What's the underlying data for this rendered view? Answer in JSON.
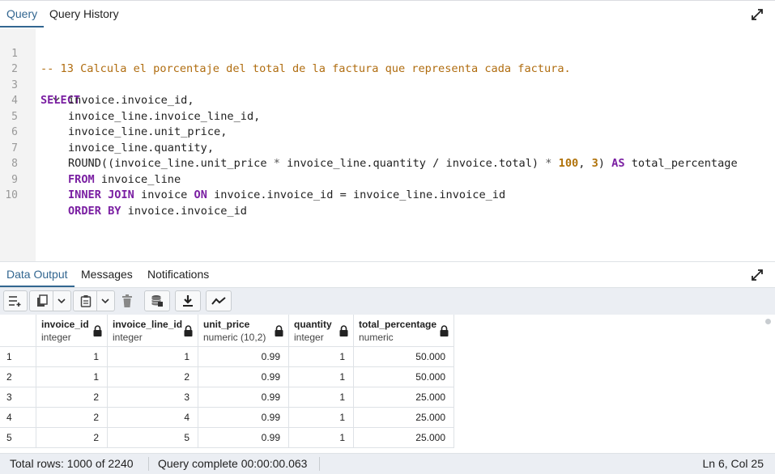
{
  "query_tabs": [
    "Query",
    "Query History"
  ],
  "editor": {
    "line_numbers": [
      "1",
      "2",
      "3",
      "4",
      "5",
      "6",
      "7",
      "8",
      "9",
      "10"
    ],
    "lines": {
      "l1": "-- 13 Calcula el porcentaje del total de la factura que representa cada factura.",
      "l2_kw": "SELECT",
      "l3": "invoice.invoice_id,",
      "l4": "invoice_line.invoice_line_id,",
      "l5": "invoice_line.unit_price,",
      "l6": "invoice_line.quantity,",
      "l7_a": "ROUND((invoice_line.unit_price ",
      "l7_op1": "*",
      "l7_b": " invoice_line.quantity / invoice.total) ",
      "l7_op2": "*",
      "l7_num1": "100",
      "l7_c": ", ",
      "l7_num2": "3",
      "l7_d": ") ",
      "l7_kw": "AS",
      "l7_e": " total_percentage",
      "l8_kw": "FROM",
      "l8": " invoice_line",
      "l9_kw1": "INNER JOIN",
      "l9_a": " invoice ",
      "l9_kw2": "ON",
      "l9_b": " invoice.invoice_id = invoice_line.invoice_id",
      "l10_kw": "ORDER BY",
      "l10": " invoice.invoice_id"
    }
  },
  "output_tabs": [
    "Data Output",
    "Messages",
    "Notifications"
  ],
  "toolbar_icons": [
    "add-row-icon",
    "copy-icon",
    "chevron-down-icon",
    "paste-icon",
    "chevron-down-icon",
    "delete-icon",
    "save-data-icon",
    "download-icon",
    "graph-icon"
  ],
  "grid": {
    "columns": [
      {
        "name": "invoice_id",
        "type": "integer"
      },
      {
        "name": "invoice_line_id",
        "type": "integer"
      },
      {
        "name": "unit_price",
        "type": "numeric (10,2)"
      },
      {
        "name": "quantity",
        "type": "integer"
      },
      {
        "name": "total_percentage",
        "type": "numeric"
      }
    ],
    "rows": [
      {
        "n": "1",
        "cells": [
          "1",
          "1",
          "0.99",
          "1",
          "50.000"
        ]
      },
      {
        "n": "2",
        "cells": [
          "1",
          "2",
          "0.99",
          "1",
          "50.000"
        ]
      },
      {
        "n": "3",
        "cells": [
          "2",
          "3",
          "0.99",
          "1",
          "25.000"
        ]
      },
      {
        "n": "4",
        "cells": [
          "2",
          "4",
          "0.99",
          "1",
          "25.000"
        ]
      },
      {
        "n": "5",
        "cells": [
          "2",
          "5",
          "0.99",
          "1",
          "25.000"
        ]
      }
    ]
  },
  "status": {
    "total_rows": "Total rows: 1000 of 2240",
    "query_complete": "Query complete 00:00:00.063",
    "cursor": "Ln 6, Col 25"
  },
  "colors": {
    "accent": "#326690",
    "keyword": "#7a1fa2",
    "comment": "#b06d10"
  }
}
